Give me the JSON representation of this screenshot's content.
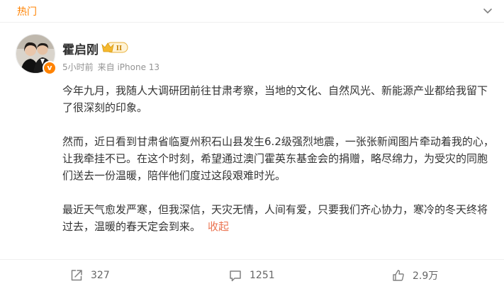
{
  "header": {
    "label": "热门"
  },
  "post": {
    "author": "霍启刚",
    "badge_text": "II",
    "verified_text": "v",
    "time": "5小时前",
    "source": "来自 iPhone 13",
    "paragraphs": [
      "今年九月，我随人大调研团前往甘肃考察，当地的文化、自然风光、新能源产业都给我留下了很深刻的印象。",
      "然而，近日看到甘肃省临夏州积石山县发生6.2级强烈地震，一张张新闻图片牵动着我的心，让我牵挂不已。在这个时刻，希望通过澳门霍英东基金会的捐赠，略尽绵力，为受灾的同胞们送去一份温暖，陪伴他们度过这段艰难时光。",
      "最近天气愈发严寒，但我深信，天灾无情，人间有爱，只要我们齐心协力，寒冷的冬天终将过去，温暖的春天定会到来。"
    ],
    "collapse_label": "收起"
  },
  "actions": {
    "repost_count": "327",
    "comment_count": "1251",
    "like_count": "2.9万"
  },
  "colors": {
    "accent_orange": "#ff8200",
    "link": "#eb7350",
    "muted": "#939393"
  },
  "icons": {
    "chevron": "chevron-down-icon",
    "crown": "crown-badge-icon",
    "repost": "repost-icon",
    "comment": "comment-icon",
    "like": "thumb-up-icon"
  }
}
